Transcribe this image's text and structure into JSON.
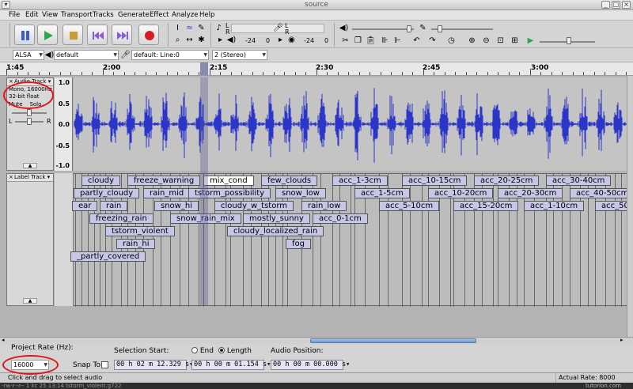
{
  "window": {
    "title": "source"
  },
  "menu": [
    "File",
    "Edit",
    "View",
    "Transport",
    "Tracks",
    "Generate",
    "Effect",
    "Analyze",
    "Help"
  ],
  "meters": {
    "left_value": "-24",
    "zero_a": "0",
    "right_value": "-24",
    "zero_b": "0",
    "ch_l": "L",
    "ch_r": "R"
  },
  "device": {
    "host": "ALSA",
    "output": "default",
    "input": "default: Line:0",
    "channels": "2 (Stereo)"
  },
  "timeline": {
    "labels": [
      "1:45",
      "2:00",
      "2:15",
      "2:30",
      "2:45",
      "3:00"
    ]
  },
  "audio_track": {
    "name": "Audio Track",
    "format": "Mono, 16000Hz",
    "depth": "32-bit float",
    "mute": "Mute",
    "solo": "Solo",
    "pan_l": "L",
    "pan_r": "R",
    "scale": [
      "1.0",
      "0.5",
      "0.0",
      "-0.5",
      "-1.0"
    ]
  },
  "label_track": {
    "name": "Label Track",
    "labels": [
      "cloudy",
      "freeze_warning",
      "mix_cond",
      "few_clouds",
      "acc_1-3cm",
      "acc_10-15cm",
      "acc_20-25cm",
      "acc_30-40cm",
      "partly_cloudy",
      "rain_mid",
      "tstorm_possibility",
      "snow_low",
      "acc_1-5cm",
      "acc_10-20cm",
      "acc_20-30cm",
      "acc_40-50cm",
      "ear",
      "rain",
      "snow_hi",
      "cloudy_w_tstorm",
      "rain_low",
      "acc_5-10cm",
      "acc_15-20cm",
      "acc_1-10cm",
      "acc_50",
      "freezing_rain",
      "snow_rain_mix",
      "mostly_sunny",
      "acc_0-1cm",
      "tstorm_violent",
      "cloudy_localized_rain",
      "rain_hi",
      "fog",
      "_partly_covered"
    ]
  },
  "selection": {
    "project_rate_label": "Project Rate (Hz):",
    "project_rate": "16000",
    "snap_to": "Snap To",
    "sel_start_label": "Selection Start:",
    "end": "End",
    "length": "Length",
    "audio_pos_label": "Audio Position:",
    "start": "00 h 02 m 12.329 s",
    "length_val": "00 h 00 m 01.154 s",
    "audio_pos": "00 h 00 m 00.000 s"
  },
  "status": {
    "hint": "Click and drag to select audio",
    "rate": "Actual Rate: 8000"
  },
  "terminal": "-rw-r--r-- 1 kc  25 13:14 tstorm_violent.g722",
  "watermark": "tutorion.com",
  "colors": {
    "waveform": "#2b35c8",
    "label_fill": "#c6c6e6",
    "annotation": "#e0161c"
  }
}
